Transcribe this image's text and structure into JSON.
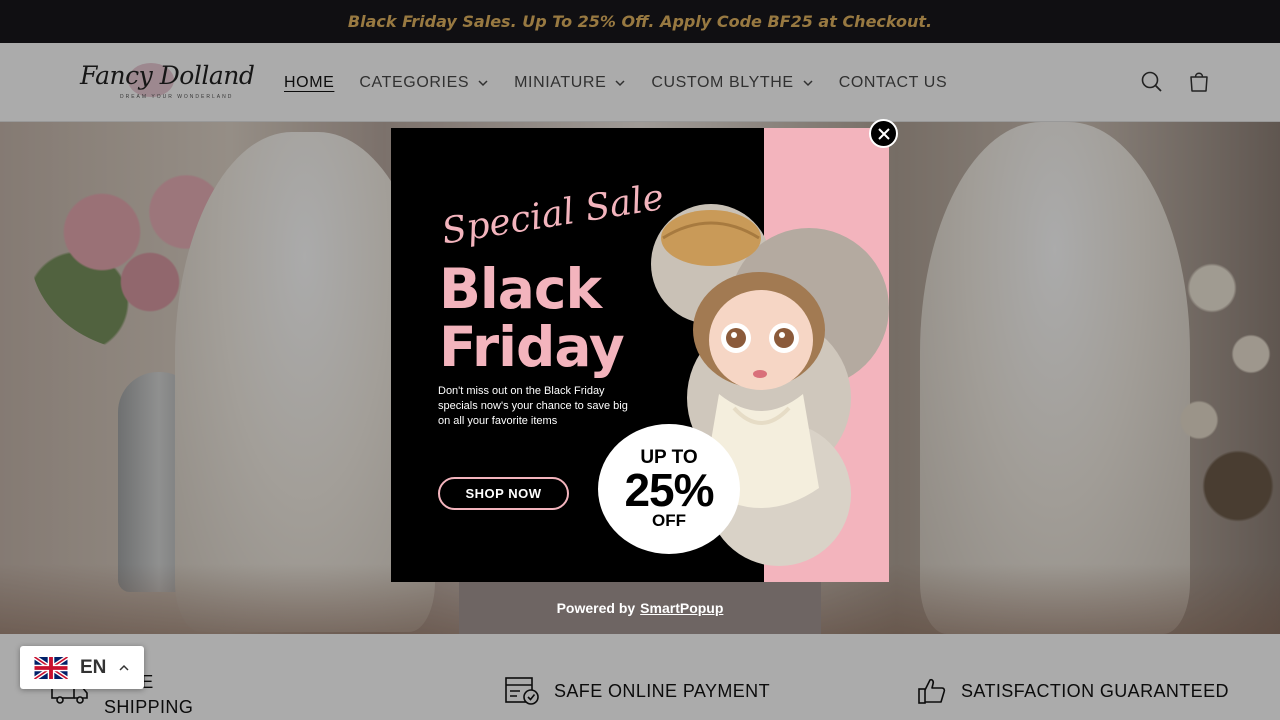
{
  "announcement": "Black Friday Sales. Up To 25% Off. Apply Code BF25 at Checkout.",
  "brand": {
    "name": "Fancy Dolland",
    "tagline": "DREAM YOUR WONDERLAND"
  },
  "nav": [
    {
      "label": "HOME",
      "active": true,
      "dropdown": false
    },
    {
      "label": "CATEGORIES",
      "dropdown": true
    },
    {
      "label": "MINIATURE",
      "dropdown": true
    },
    {
      "label": "CUSTOM BLYTHE",
      "dropdown": true
    },
    {
      "label": "CONTACT US",
      "dropdown": false
    }
  ],
  "header_icons": [
    "search-icon",
    "cart-icon"
  ],
  "popup": {
    "script_title": "Special Sale",
    "title_line1": "Black",
    "title_line2": "Friday",
    "description": "Don't miss out on the Black Friday specials now's your chance to save big on all your favorite items",
    "cta": "SHOP NOW",
    "badge_line1": "UP TO",
    "badge_line2": "25%",
    "badge_line3": "OFF",
    "powered_prefix": "Powered by",
    "powered_link": "SmartPopup",
    "colors": {
      "pink": "#f3b4bd",
      "background": "#000000"
    }
  },
  "features": [
    {
      "label_line1": "FREE",
      "label_line2": "SHIPPING",
      "icon": "truck-icon"
    },
    {
      "label": "SAFE ONLINE PAYMENT",
      "icon": "secure-payment-icon"
    },
    {
      "label": "SATISFACTION GUARANTEED",
      "icon": "thumbs-up-icon"
    }
  ],
  "language": {
    "code": "EN",
    "flag": "uk-flag-icon"
  },
  "colors": {
    "announcement_bg": "#18171c",
    "announcement_text": "#e3b562"
  }
}
